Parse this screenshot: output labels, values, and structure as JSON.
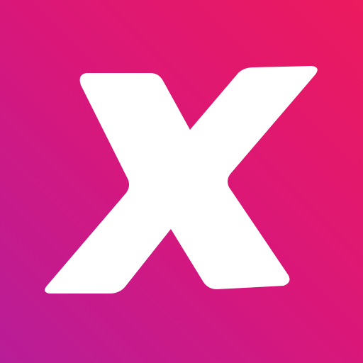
{
  "icon": {
    "name": "x-logo-icon",
    "colors": {
      "gradient_top_right": "#ec1a5e",
      "gradient_mid": "#d9177a",
      "gradient_bottom_left": "#b81d98",
      "glyph": "#ffffff"
    }
  }
}
